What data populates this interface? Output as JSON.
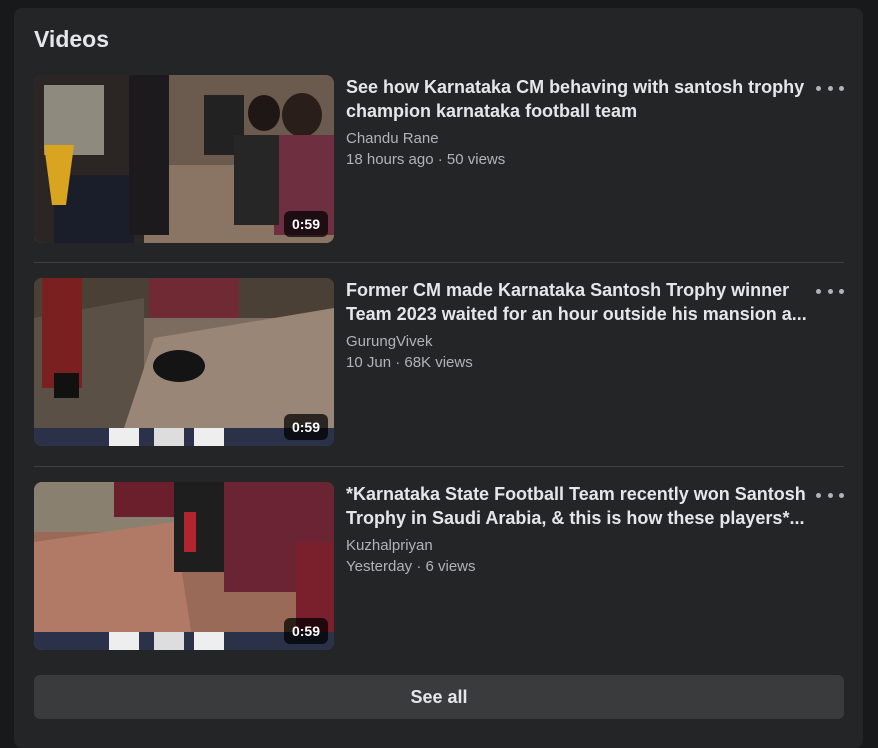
{
  "section": {
    "title": "Videos",
    "see_all_label": "See all"
  },
  "videos": [
    {
      "title": "See how Karnataka CM behaving with santosh trophy champion karnataka football team",
      "author": "Chandu Rane",
      "meta": "18 hours ago · 50 views",
      "duration": "0:59",
      "more_icon": "more-horizontal-icon"
    },
    {
      "title": "Former CM made Karnataka Santosh Trophy winner Team 2023 waited for an hour outside his mansion a...",
      "author": "GurungVivek",
      "meta": "10 Jun · 68K views",
      "duration": "0:59",
      "more_icon": "more-horizontal-icon"
    },
    {
      "title": "*Karnataka State Football Team recently won Santosh Trophy in Saudi Arabia, & this is how these players*...",
      "author": "Kuzhalpriyan",
      "meta": "Yesterday · 6 views",
      "duration": "0:59",
      "more_icon": "more-horizontal-icon"
    }
  ],
  "colors": {
    "background": "#18191a",
    "card": "#242526",
    "primary_text": "#e4e6eb",
    "secondary_text": "#b0b3b8",
    "button": "#3a3b3c"
  }
}
